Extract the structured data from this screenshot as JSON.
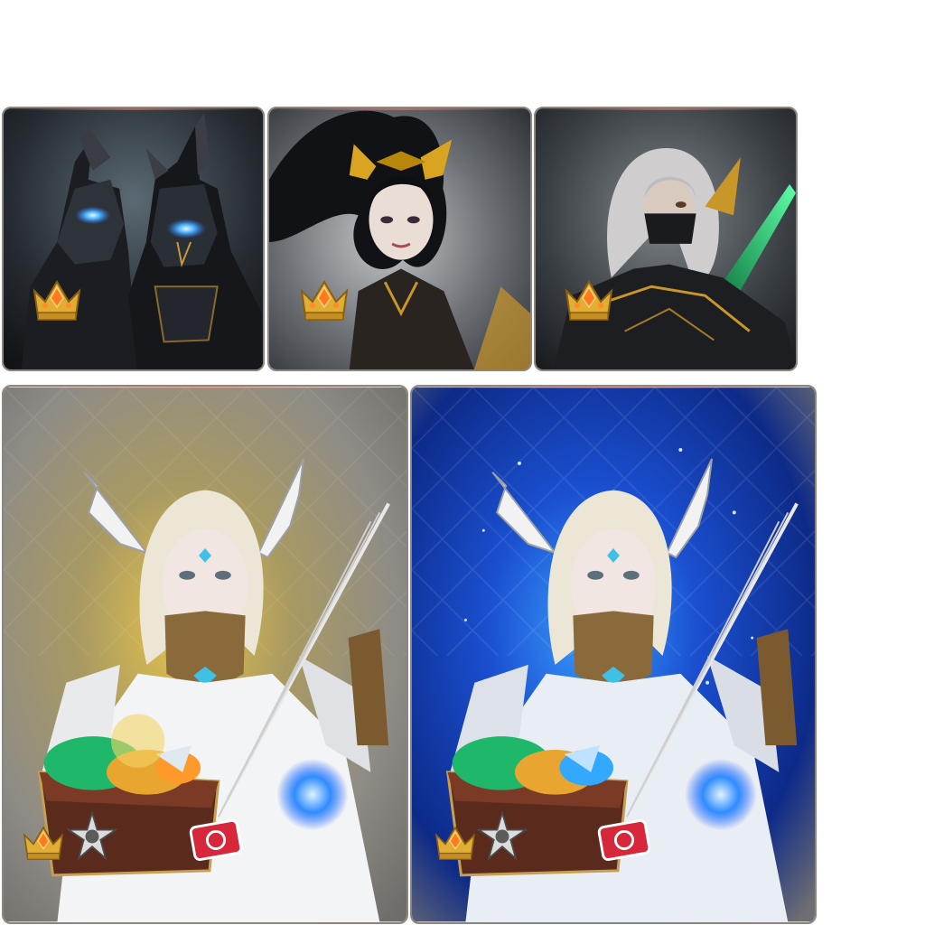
{
  "top_row": {
    "cards": [
      {
        "subject": "twin-horned-knights",
        "accent": "#3fa9ff",
        "badge": "crown-gem-icon"
      },
      {
        "subject": "dark-haired-sorceress",
        "accent": "#d9a520",
        "badge": "crown-gem-icon"
      },
      {
        "subject": "masked-silver-haired-assassin",
        "accent": "#3ee08a",
        "badge": "crown-gem-icon"
      }
    ]
  },
  "bottom_row": {
    "cards": [
      {
        "subject": "winged-bard-with-harp",
        "glow": "#e0b52a",
        "background": "#8d8a84",
        "icons": [
          "crown-gem-icon",
          "silver-star-emblem-icon",
          "red-ticket-icon",
          "treasure-chest-icon",
          "blue-crystal-icon"
        ]
      },
      {
        "subject": "winged-bard-with-harp",
        "glow": "#1d66ff",
        "background": "#0a1f6e",
        "icons": [
          "crown-gem-icon",
          "silver-star-emblem-icon",
          "red-ticket-icon",
          "treasure-chest-icon",
          "blue-crystal-icon"
        ]
      }
    ]
  },
  "colors": {
    "card_border": "#8b8680",
    "gold": "#d8a530",
    "crystal_blue": "#2f8cff",
    "ticket_red": "#d6283a",
    "gem_green": "#1fb86a"
  }
}
